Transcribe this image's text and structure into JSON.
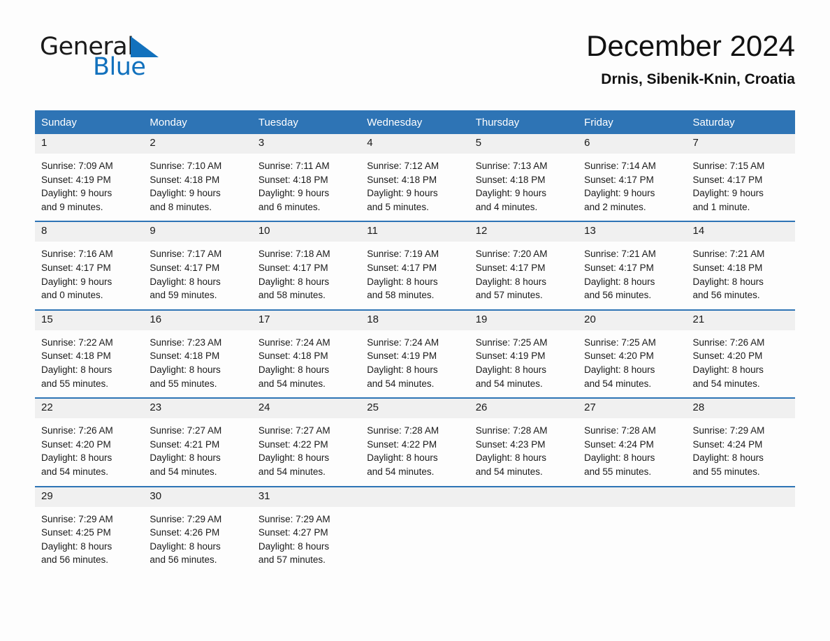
{
  "brand": {
    "name_part1": "General",
    "name_part2": "Blue"
  },
  "header": {
    "title": "December 2024",
    "location": "Drnis, Sibenik-Knin, Croatia"
  },
  "weekdays": [
    "Sunday",
    "Monday",
    "Tuesday",
    "Wednesday",
    "Thursday",
    "Friday",
    "Saturday"
  ],
  "colors": {
    "header_blue": "#2e74b5",
    "daynum_band": "#f0f0f0",
    "logo_blue": "#1271bd",
    "page_background": "#fdfdfd"
  },
  "weeks": [
    [
      {
        "day": "1",
        "sunrise": "Sunrise: 7:09 AM",
        "sunset": "Sunset: 4:19 PM",
        "daylight_line1": "Daylight: 9 hours",
        "daylight_line2": "and 9 minutes."
      },
      {
        "day": "2",
        "sunrise": "Sunrise: 7:10 AM",
        "sunset": "Sunset: 4:18 PM",
        "daylight_line1": "Daylight: 9 hours",
        "daylight_line2": "and 8 minutes."
      },
      {
        "day": "3",
        "sunrise": "Sunrise: 7:11 AM",
        "sunset": "Sunset: 4:18 PM",
        "daylight_line1": "Daylight: 9 hours",
        "daylight_line2": "and 6 minutes."
      },
      {
        "day": "4",
        "sunrise": "Sunrise: 7:12 AM",
        "sunset": "Sunset: 4:18 PM",
        "daylight_line1": "Daylight: 9 hours",
        "daylight_line2": "and 5 minutes."
      },
      {
        "day": "5",
        "sunrise": "Sunrise: 7:13 AM",
        "sunset": "Sunset: 4:18 PM",
        "daylight_line1": "Daylight: 9 hours",
        "daylight_line2": "and 4 minutes."
      },
      {
        "day": "6",
        "sunrise": "Sunrise: 7:14 AM",
        "sunset": "Sunset: 4:17 PM",
        "daylight_line1": "Daylight: 9 hours",
        "daylight_line2": "and 2 minutes."
      },
      {
        "day": "7",
        "sunrise": "Sunrise: 7:15 AM",
        "sunset": "Sunset: 4:17 PM",
        "daylight_line1": "Daylight: 9 hours",
        "daylight_line2": "and 1 minute."
      }
    ],
    [
      {
        "day": "8",
        "sunrise": "Sunrise: 7:16 AM",
        "sunset": "Sunset: 4:17 PM",
        "daylight_line1": "Daylight: 9 hours",
        "daylight_line2": "and 0 minutes."
      },
      {
        "day": "9",
        "sunrise": "Sunrise: 7:17 AM",
        "sunset": "Sunset: 4:17 PM",
        "daylight_line1": "Daylight: 8 hours",
        "daylight_line2": "and 59 minutes."
      },
      {
        "day": "10",
        "sunrise": "Sunrise: 7:18 AM",
        "sunset": "Sunset: 4:17 PM",
        "daylight_line1": "Daylight: 8 hours",
        "daylight_line2": "and 58 minutes."
      },
      {
        "day": "11",
        "sunrise": "Sunrise: 7:19 AM",
        "sunset": "Sunset: 4:17 PM",
        "daylight_line1": "Daylight: 8 hours",
        "daylight_line2": "and 58 minutes."
      },
      {
        "day": "12",
        "sunrise": "Sunrise: 7:20 AM",
        "sunset": "Sunset: 4:17 PM",
        "daylight_line1": "Daylight: 8 hours",
        "daylight_line2": "and 57 minutes."
      },
      {
        "day": "13",
        "sunrise": "Sunrise: 7:21 AM",
        "sunset": "Sunset: 4:17 PM",
        "daylight_line1": "Daylight: 8 hours",
        "daylight_line2": "and 56 minutes."
      },
      {
        "day": "14",
        "sunrise": "Sunrise: 7:21 AM",
        "sunset": "Sunset: 4:18 PM",
        "daylight_line1": "Daylight: 8 hours",
        "daylight_line2": "and 56 minutes."
      }
    ],
    [
      {
        "day": "15",
        "sunrise": "Sunrise: 7:22 AM",
        "sunset": "Sunset: 4:18 PM",
        "daylight_line1": "Daylight: 8 hours",
        "daylight_line2": "and 55 minutes."
      },
      {
        "day": "16",
        "sunrise": "Sunrise: 7:23 AM",
        "sunset": "Sunset: 4:18 PM",
        "daylight_line1": "Daylight: 8 hours",
        "daylight_line2": "and 55 minutes."
      },
      {
        "day": "17",
        "sunrise": "Sunrise: 7:24 AM",
        "sunset": "Sunset: 4:18 PM",
        "daylight_line1": "Daylight: 8 hours",
        "daylight_line2": "and 54 minutes."
      },
      {
        "day": "18",
        "sunrise": "Sunrise: 7:24 AM",
        "sunset": "Sunset: 4:19 PM",
        "daylight_line1": "Daylight: 8 hours",
        "daylight_line2": "and 54 minutes."
      },
      {
        "day": "19",
        "sunrise": "Sunrise: 7:25 AM",
        "sunset": "Sunset: 4:19 PM",
        "daylight_line1": "Daylight: 8 hours",
        "daylight_line2": "and 54 minutes."
      },
      {
        "day": "20",
        "sunrise": "Sunrise: 7:25 AM",
        "sunset": "Sunset: 4:20 PM",
        "daylight_line1": "Daylight: 8 hours",
        "daylight_line2": "and 54 minutes."
      },
      {
        "day": "21",
        "sunrise": "Sunrise: 7:26 AM",
        "sunset": "Sunset: 4:20 PM",
        "daylight_line1": "Daylight: 8 hours",
        "daylight_line2": "and 54 minutes."
      }
    ],
    [
      {
        "day": "22",
        "sunrise": "Sunrise: 7:26 AM",
        "sunset": "Sunset: 4:20 PM",
        "daylight_line1": "Daylight: 8 hours",
        "daylight_line2": "and 54 minutes."
      },
      {
        "day": "23",
        "sunrise": "Sunrise: 7:27 AM",
        "sunset": "Sunset: 4:21 PM",
        "daylight_line1": "Daylight: 8 hours",
        "daylight_line2": "and 54 minutes."
      },
      {
        "day": "24",
        "sunrise": "Sunrise: 7:27 AM",
        "sunset": "Sunset: 4:22 PM",
        "daylight_line1": "Daylight: 8 hours",
        "daylight_line2": "and 54 minutes."
      },
      {
        "day": "25",
        "sunrise": "Sunrise: 7:28 AM",
        "sunset": "Sunset: 4:22 PM",
        "daylight_line1": "Daylight: 8 hours",
        "daylight_line2": "and 54 minutes."
      },
      {
        "day": "26",
        "sunrise": "Sunrise: 7:28 AM",
        "sunset": "Sunset: 4:23 PM",
        "daylight_line1": "Daylight: 8 hours",
        "daylight_line2": "and 54 minutes."
      },
      {
        "day": "27",
        "sunrise": "Sunrise: 7:28 AM",
        "sunset": "Sunset: 4:24 PM",
        "daylight_line1": "Daylight: 8 hours",
        "daylight_line2": "and 55 minutes."
      },
      {
        "day": "28",
        "sunrise": "Sunrise: 7:29 AM",
        "sunset": "Sunset: 4:24 PM",
        "daylight_line1": "Daylight: 8 hours",
        "daylight_line2": "and 55 minutes."
      }
    ],
    [
      {
        "day": "29",
        "sunrise": "Sunrise: 7:29 AM",
        "sunset": "Sunset: 4:25 PM",
        "daylight_line1": "Daylight: 8 hours",
        "daylight_line2": "and 56 minutes."
      },
      {
        "day": "30",
        "sunrise": "Sunrise: 7:29 AM",
        "sunset": "Sunset: 4:26 PM",
        "daylight_line1": "Daylight: 8 hours",
        "daylight_line2": "and 56 minutes."
      },
      {
        "day": "31",
        "sunrise": "Sunrise: 7:29 AM",
        "sunset": "Sunset: 4:27 PM",
        "daylight_line1": "Daylight: 8 hours",
        "daylight_line2": "and 57 minutes."
      },
      {
        "day": "",
        "sunrise": "",
        "sunset": "",
        "daylight_line1": "",
        "daylight_line2": ""
      },
      {
        "day": "",
        "sunrise": "",
        "sunset": "",
        "daylight_line1": "",
        "daylight_line2": ""
      },
      {
        "day": "",
        "sunrise": "",
        "sunset": "",
        "daylight_line1": "",
        "daylight_line2": ""
      },
      {
        "day": "",
        "sunrise": "",
        "sunset": "",
        "daylight_line1": "",
        "daylight_line2": ""
      }
    ]
  ]
}
